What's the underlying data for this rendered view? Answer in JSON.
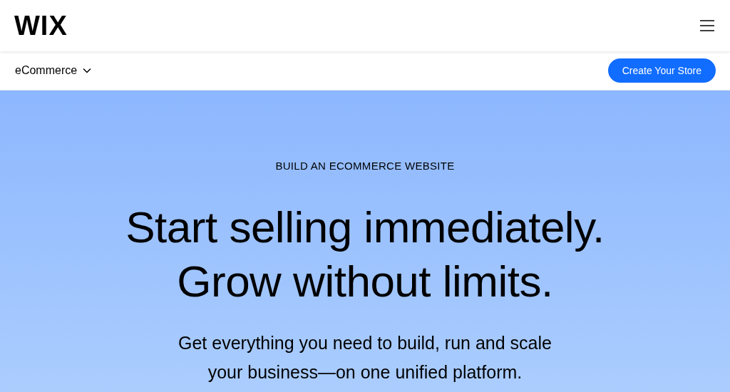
{
  "header": {
    "logo": "WIX"
  },
  "subnav": {
    "menu": "eCommerce",
    "cta": "Create Your Store"
  },
  "hero": {
    "eyebrow": "BUILD AN ECOMMERCE WEBSITE",
    "headline": [
      "Start selling immediately.",
      "Grow without limits."
    ],
    "subtitle": [
      "Get everything you need to build, run and scale",
      "your business—on one unified platform."
    ]
  }
}
